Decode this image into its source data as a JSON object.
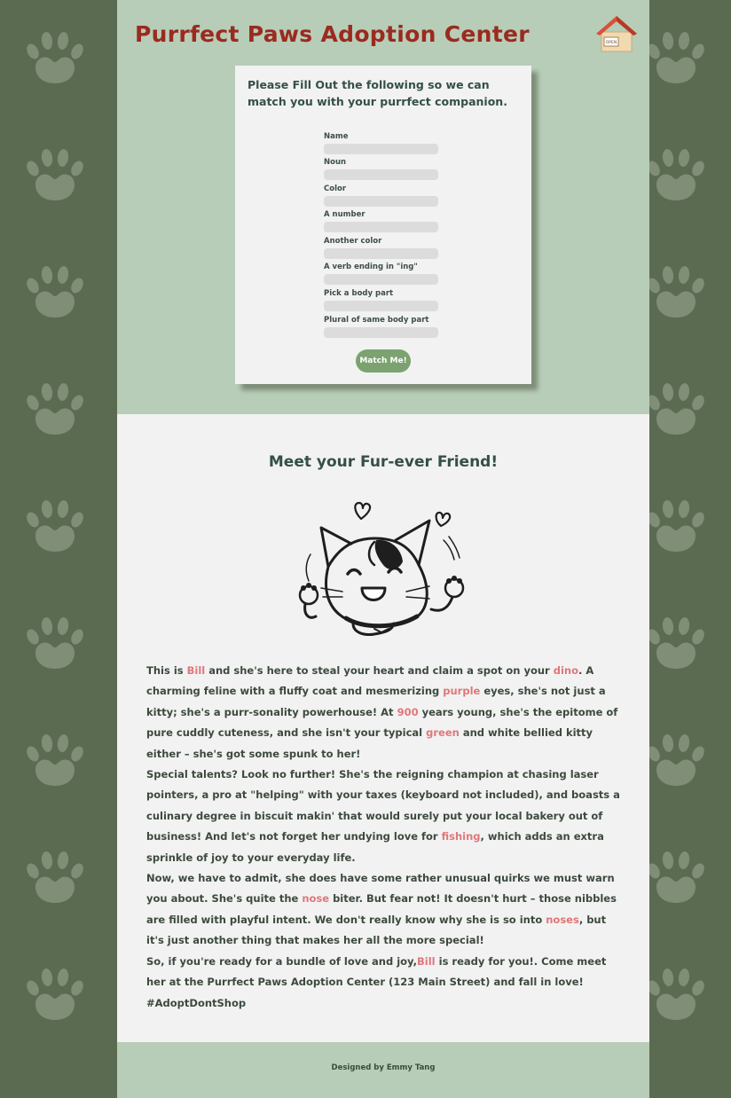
{
  "header": {
    "title": "Purrfect Paws Adoption Center",
    "house_sign": "OPEN"
  },
  "form": {
    "intro": "Please Fill Out the following so we can match you with your purrfect companion.",
    "fields": [
      {
        "label": "Name",
        "value": ""
      },
      {
        "label": "Noun",
        "value": ""
      },
      {
        "label": "Color",
        "value": ""
      },
      {
        "label": "A number",
        "value": ""
      },
      {
        "label": "Another color",
        "value": ""
      },
      {
        "label": "A verb ending in \"ing\"",
        "value": ""
      },
      {
        "label": "Pick a body part",
        "value": ""
      },
      {
        "label": "Plural of same body part",
        "value": ""
      }
    ],
    "submit_label": "Match Me!"
  },
  "story": {
    "heading": "Meet your Fur-ever Friend!",
    "p1": {
      "t1": "This is ",
      "name": "Bill",
      "t2": " and she's here to steal your heart and claim a spot on your ",
      "noun": "dino",
      "t3": ". A charming feline with a fluffy coat and mesmerizing ",
      "color": "purple",
      "t4": " eyes, she's not just a kitty; she's a purr-sonality powerhouse! At ",
      "number": "900",
      "t5": " years young, she's the epitome of pure cuddly cuteness, and she isn't your typical ",
      "color2": "green",
      "t6": " and white bellied kitty either – she's got some spunk to her!"
    },
    "p2": {
      "t1": "Special talents? Look no further! She's the reigning champion at chasing laser pointers, a pro at \"helping\" with your taxes (keyboard not included), and boasts a culinary degree in biscuit makin' that would surely put your local bakery out of business! And let's not forget her undying love for ",
      "verb": "fishing",
      "t2": ", which adds an extra sprinkle of joy to your everyday life."
    },
    "p3": {
      "t1": "Now, we have to admit, she does have some rather unusual quirks we must warn you about. She's quite the ",
      "body_part": "nose",
      "t2": " biter. But fear not! It doesn't hurt – those nibbles are filled with playful intent. We don't really know why she is so into ",
      "body_parts": "noses",
      "t3": ", but it's just another thing that makes her all the more special!"
    },
    "p4": {
      "t1": "So, if you're ready for a bundle of love and joy,",
      "name": "Bill",
      "t2": " is ready for you!. Come meet her at the Purrfect Paws Adoption Center (123 Main Street) and fall in love! #AdoptDontShop"
    }
  },
  "footer": {
    "credit": "Designed by Emmy Tang"
  },
  "colors": {
    "background": "#5b6b52",
    "sage": "#b7cdb7",
    "title_red": "#9b2a1f",
    "highlight": "#e0777a",
    "button_green": "#7ba26f"
  }
}
